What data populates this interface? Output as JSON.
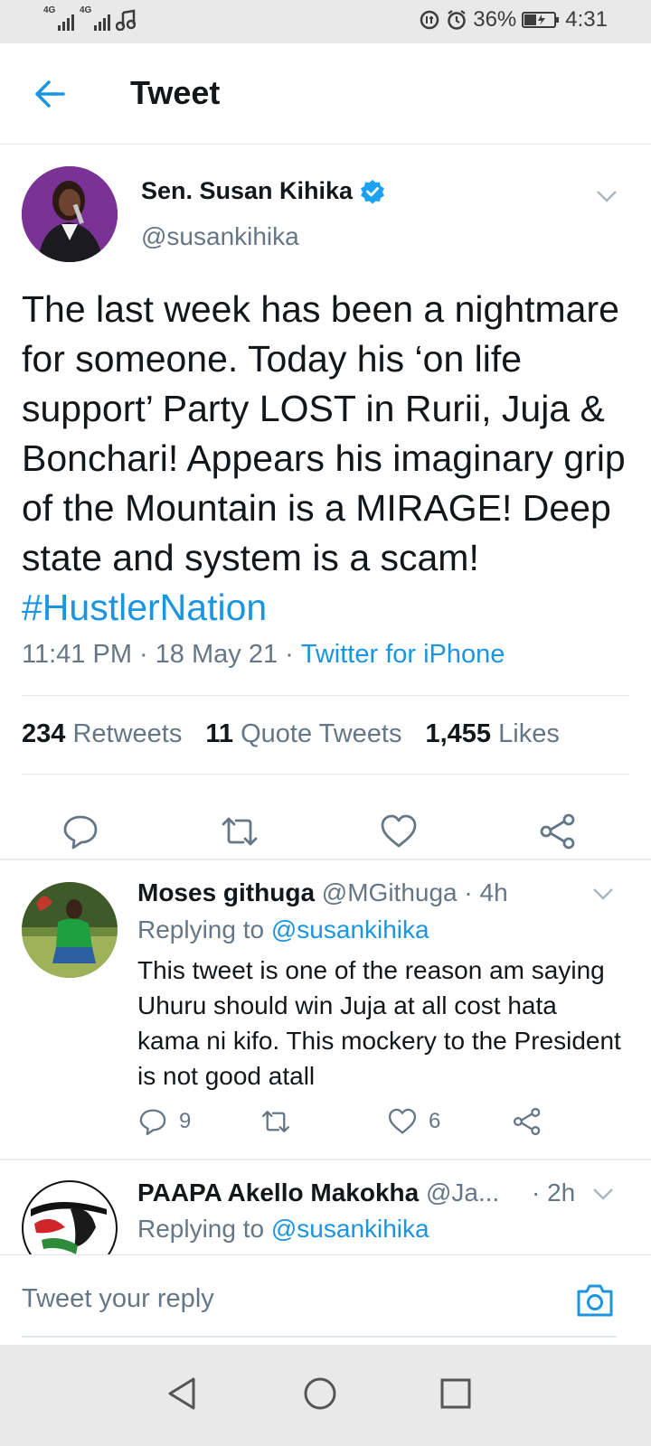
{
  "status_bar": {
    "network_1": "4G",
    "network_2": "4G",
    "battery": "36%",
    "time": "4:31"
  },
  "header": {
    "title": "Tweet"
  },
  "tweet": {
    "author_name": "Sen. Susan Kihika",
    "author_handle": "@susankihika",
    "text": "The last week has been a nightmare for someone. Today his ‘on life support’ Party LOST in Rurii, Juja & Bonchari! Appears his imaginary grip of the Mountain is a MIRAGE! Deep state and system is a scam!",
    "hashtag": "#HustlerNation",
    "time": "11:41 PM",
    "date": "18 May 21",
    "source": "Twitter for iPhone",
    "dot": "·",
    "stats": {
      "retweets_count": "234",
      "retweets_label": "Retweets",
      "quotes_count": "11",
      "quotes_label": "Quote Tweets",
      "likes_count": "1,455",
      "likes_label": "Likes"
    }
  },
  "replies": [
    {
      "name": "Moses githuga",
      "handle": "@MGithuga",
      "time": "· 4h",
      "replying_prefix": "Replying to",
      "replying_handle": "@susankihika",
      "text": "This tweet is one of the reason am saying Uhuru should win Juja at all cost hata kama ni kifo. This mockery to the President is not good atall",
      "reply_count": "9",
      "retweet_count": "",
      "like_count": "6"
    },
    {
      "name": "PAAPA Akello Makokha",
      "handle": "@Ja...",
      "time": "· 2h",
      "replying_prefix": "Replying to",
      "replying_handle": "@susankihika"
    }
  ],
  "compose": {
    "placeholder": "Tweet your reply"
  },
  "colors": {
    "accent": "#1b95e0",
    "muted": "#657786",
    "text": "#14171a"
  },
  "icons": [
    "back-arrow-icon",
    "verified-badge-icon",
    "chevron-down-icon",
    "reply-icon",
    "retweet-icon",
    "like-icon",
    "share-icon",
    "camera-icon",
    "nav-back-icon",
    "nav-home-icon",
    "nav-recents-icon"
  ]
}
